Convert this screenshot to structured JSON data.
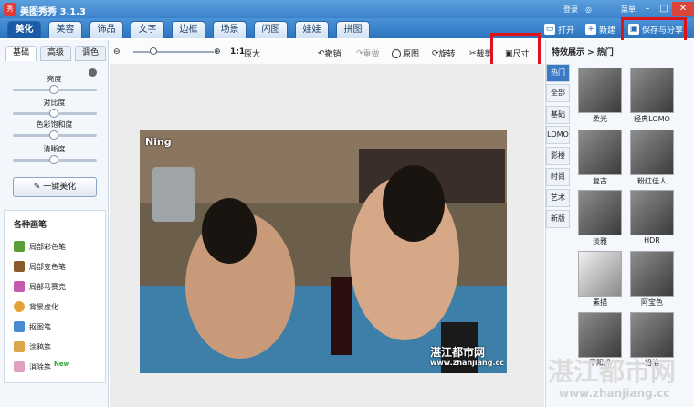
{
  "app": {
    "title": "美图秀秀 3.1.3",
    "logo": "秀",
    "login": "登录",
    "menu": "菜单"
  },
  "tabs": [
    "美化",
    "美容",
    "饰品",
    "文字",
    "边框",
    "场景",
    "闪图",
    "娃娃",
    "拼图"
  ],
  "header": {
    "open": "打开",
    "new": "新建",
    "save_share": "保存与分享"
  },
  "left": {
    "subtabs": [
      "基础",
      "高级",
      "调色"
    ],
    "sliders": [
      "亮度",
      "对比度",
      "色彩饱和度",
      "清晰度"
    ],
    "one_key": "一键美化",
    "brush_title": "各种画笔",
    "brushes": [
      "局部彩色笔",
      "局部变色笔",
      "局部马赛克",
      "背景虚化",
      "抠图笔",
      "涂鸦笔",
      "消除笔"
    ],
    "new_tag": "New"
  },
  "toolbar": {
    "ratio": "1:1",
    "original_size": "原大",
    "undo": "撤销",
    "redo": "重做",
    "original": "原图",
    "rotate": "旋转",
    "crop": "裁剪",
    "size": "尺寸"
  },
  "photo": {
    "corner_text": "Ning",
    "wm1": "湛江都市网",
    "wm2": "www.zhanjiang.cc"
  },
  "right": {
    "breadcrumb": "特效展示 > 热门",
    "categories": [
      "热门",
      "全部",
      "基础",
      "LOMO",
      "影楼",
      "时尚",
      "艺术",
      "新版"
    ],
    "effects": [
      "柔光",
      "经典LOMO",
      "复古",
      "粉红佳人",
      "淡雅",
      "HDR",
      "素描",
      "阿宝色",
      "平阳风",
      "铅笔"
    ]
  },
  "watermark": {
    "big": "湛江都市网",
    "small": "www.zhanjiang.cc"
  },
  "colors": {
    "accent": "#2c73bd",
    "highlight": "#e0121a"
  }
}
